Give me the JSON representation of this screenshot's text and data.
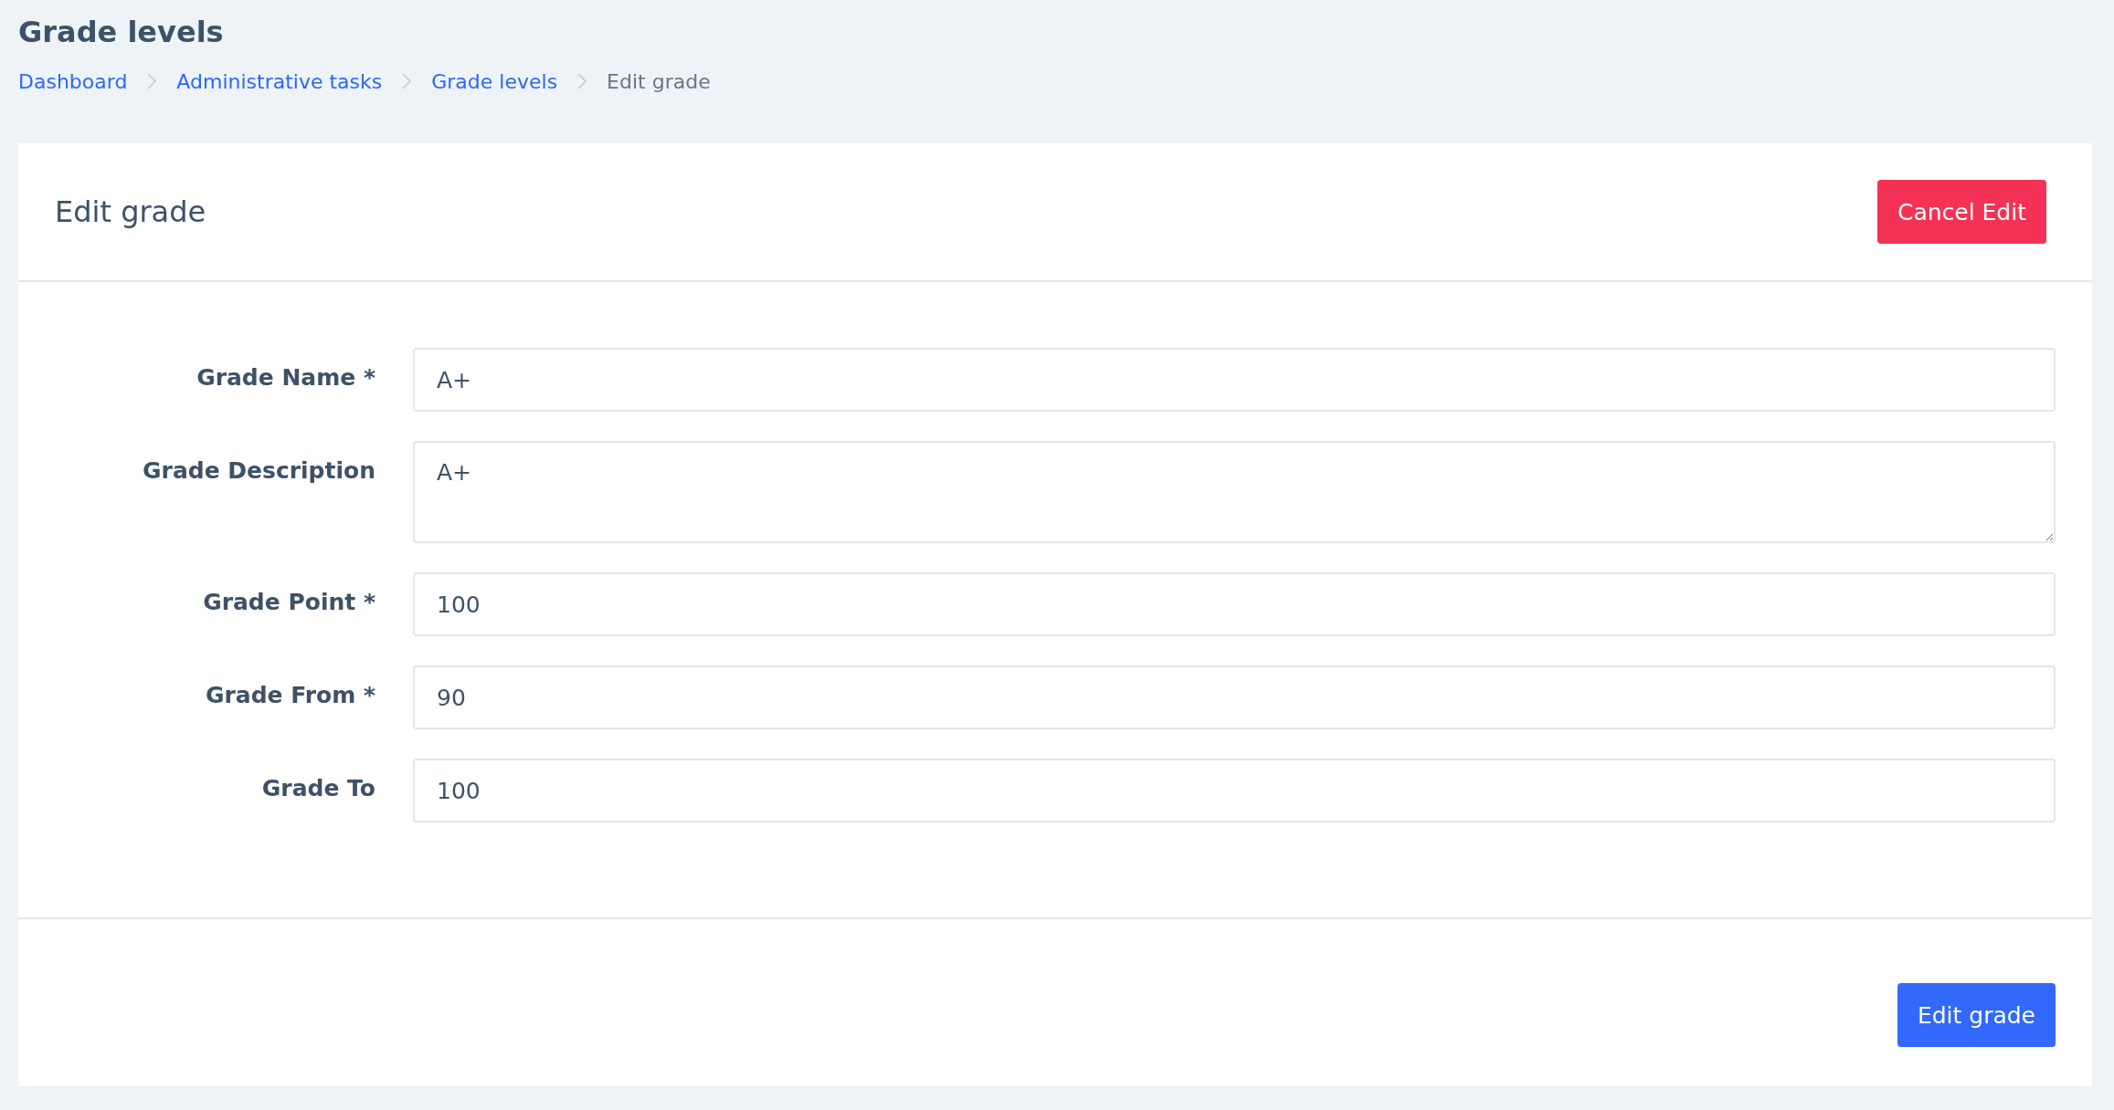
{
  "page_title": "Grade levels",
  "breadcrumb": [
    {
      "label": "Dashboard",
      "kind": "link"
    },
    {
      "label": "Administrative tasks",
      "kind": "link"
    },
    {
      "label": "Grade levels",
      "kind": "link"
    },
    {
      "label": "Edit grade",
      "kind": "current"
    }
  ],
  "card": {
    "title": "Edit grade",
    "cancel_button": "Cancel Edit",
    "fields": [
      {
        "label": "Grade Name *",
        "value": "A+",
        "kind": "input"
      },
      {
        "label": "Grade Description",
        "value": "A+",
        "kind": "textarea"
      },
      {
        "label": "Grade Point *",
        "value": "100",
        "kind": "input"
      },
      {
        "label": "Grade From *",
        "value": "90",
        "kind": "input"
      },
      {
        "label": "Grade To",
        "value": "100",
        "kind": "input"
      }
    ],
    "submit_button": "Edit grade"
  }
}
